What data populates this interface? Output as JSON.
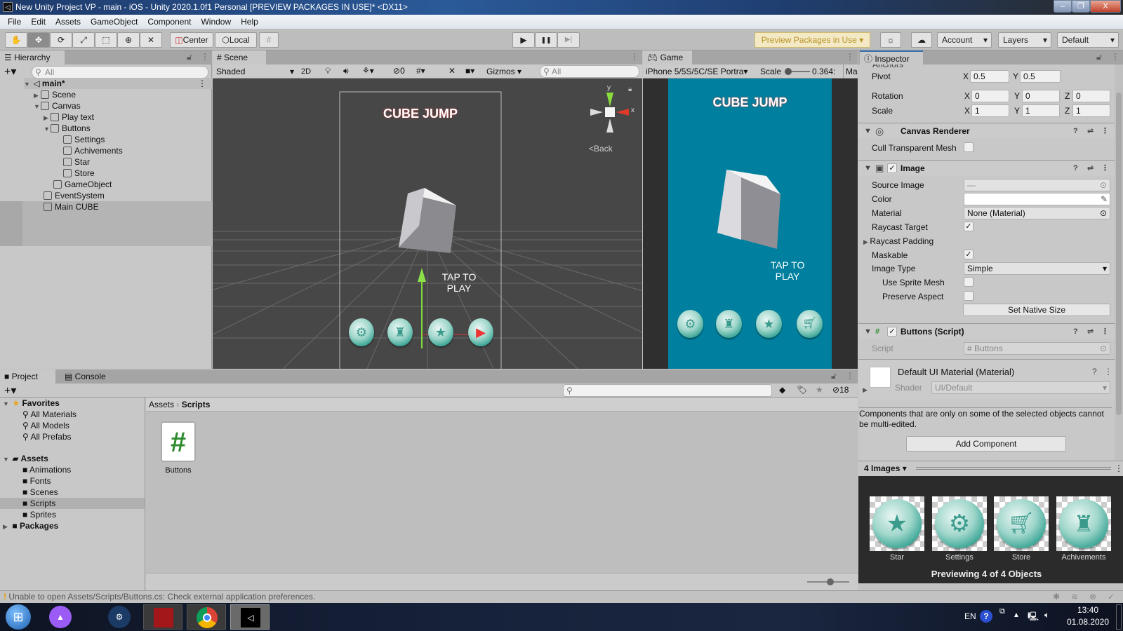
{
  "window": {
    "title": "New Unity Project VP - main - iOS - Unity 2020.1.0f1 Personal [PREVIEW PACKAGES IN USE]* <DX11>",
    "minimize": "–",
    "restore": "❐",
    "close": "X"
  },
  "menu": [
    "File",
    "Edit",
    "Assets",
    "GameObject",
    "Component",
    "Window",
    "Help"
  ],
  "toolbar": {
    "center": "Center",
    "local": "Local",
    "preview_packages": "Preview Packages in Use",
    "account": "Account",
    "layers": "Layers",
    "layout": "Default",
    "play": "▶",
    "pause": "❚❚",
    "step": "▶|"
  },
  "hierarchy": {
    "tab": "Hierarchy",
    "search_placeholder": "All",
    "root": "main*",
    "items": [
      "Scene",
      "Canvas",
      "Play text",
      "Buttons",
      "Settings",
      "Achivements",
      "Star",
      "Store",
      "GameObject",
      "EventSystem",
      "Main CUBE"
    ]
  },
  "scene": {
    "tab": "Scene",
    "shading": "Shaded",
    "mode2d": "2D",
    "hidden_count": "0",
    "gizmos": "Gizmos",
    "search_placeholder": "All",
    "title": "CUBE JUMP",
    "tap": "TAP TO",
    "play": "PLAY",
    "back": "Back",
    "axis_x": "x",
    "axis_y": "y"
  },
  "game": {
    "tab": "Game",
    "resolution": "iPhone 5/5S/5C/SE Portra",
    "scale_label": "Scale",
    "scale_value": "0.364:",
    "maximize": "Ma",
    "title": "CUBE JUMP",
    "tap": "TAP TO",
    "play": "PLAY",
    "bg_color": "#00809e"
  },
  "inspector": {
    "tab": "Inspector",
    "anchors": "Anchors",
    "pivot": {
      "label": "Pivot",
      "x": "0.5",
      "y": "0.5"
    },
    "rotation": {
      "label": "Rotation",
      "x": "0",
      "y": "0",
      "z": "0"
    },
    "scale": {
      "label": "Scale",
      "x": "1",
      "y": "1",
      "z": "1"
    },
    "axes": {
      "x": "X",
      "y": "Y",
      "z": "Z"
    },
    "canvas_renderer": {
      "title": "Canvas Renderer",
      "cull": "Cull Transparent Mesh"
    },
    "image": {
      "title": "Image",
      "source_image": "Source Image",
      "source_value": "—",
      "color": "Color",
      "material": "Material",
      "material_value": "None (Material)",
      "raycast_target": "Raycast Target",
      "raycast_padding": "Raycast Padding",
      "maskable": "Maskable",
      "image_type": "Image Type",
      "image_type_value": "Simple",
      "use_sprite_mesh": "Use Sprite Mesh",
      "preserve_aspect": "Preserve Aspect",
      "set_native_size": "Set Native Size"
    },
    "buttons_script": {
      "title": "Buttons (Script)",
      "script_label": "Script",
      "script_value": "Buttons"
    },
    "material": {
      "title": "Default UI Material (Material)",
      "shader_label": "Shader",
      "shader_value": "UI/Default"
    },
    "note": "Components that are only on some of the selected objects cannot be multi-edited.",
    "add_component": "Add Component",
    "preview": {
      "dropdown": "4 Images",
      "items": [
        "Star",
        "Settings",
        "Store",
        "Achivements"
      ],
      "caption": "Previewing 4 of 4 Objects"
    }
  },
  "project": {
    "tab": "Project",
    "console_tab": "Console",
    "hidden_count": "18",
    "favorites": {
      "label": "Favorites",
      "items": [
        "All Materials",
        "All Models",
        "All Prefabs"
      ]
    },
    "assets": {
      "label": "Assets",
      "items": [
        "Animations",
        "Fonts",
        "Scenes",
        "Scripts",
        "Sprites"
      ]
    },
    "packages": "Packages",
    "breadcrumb": [
      "Assets",
      "Scripts"
    ],
    "files": [
      {
        "name": "Buttons",
        "icon": "#"
      }
    ]
  },
  "status": {
    "message": "Unable to open Assets/Scripts/Buttons.cs: Check external application preferences."
  },
  "taskbar": {
    "lang": "EN",
    "time": "13:40",
    "date": "01.08.2020"
  }
}
